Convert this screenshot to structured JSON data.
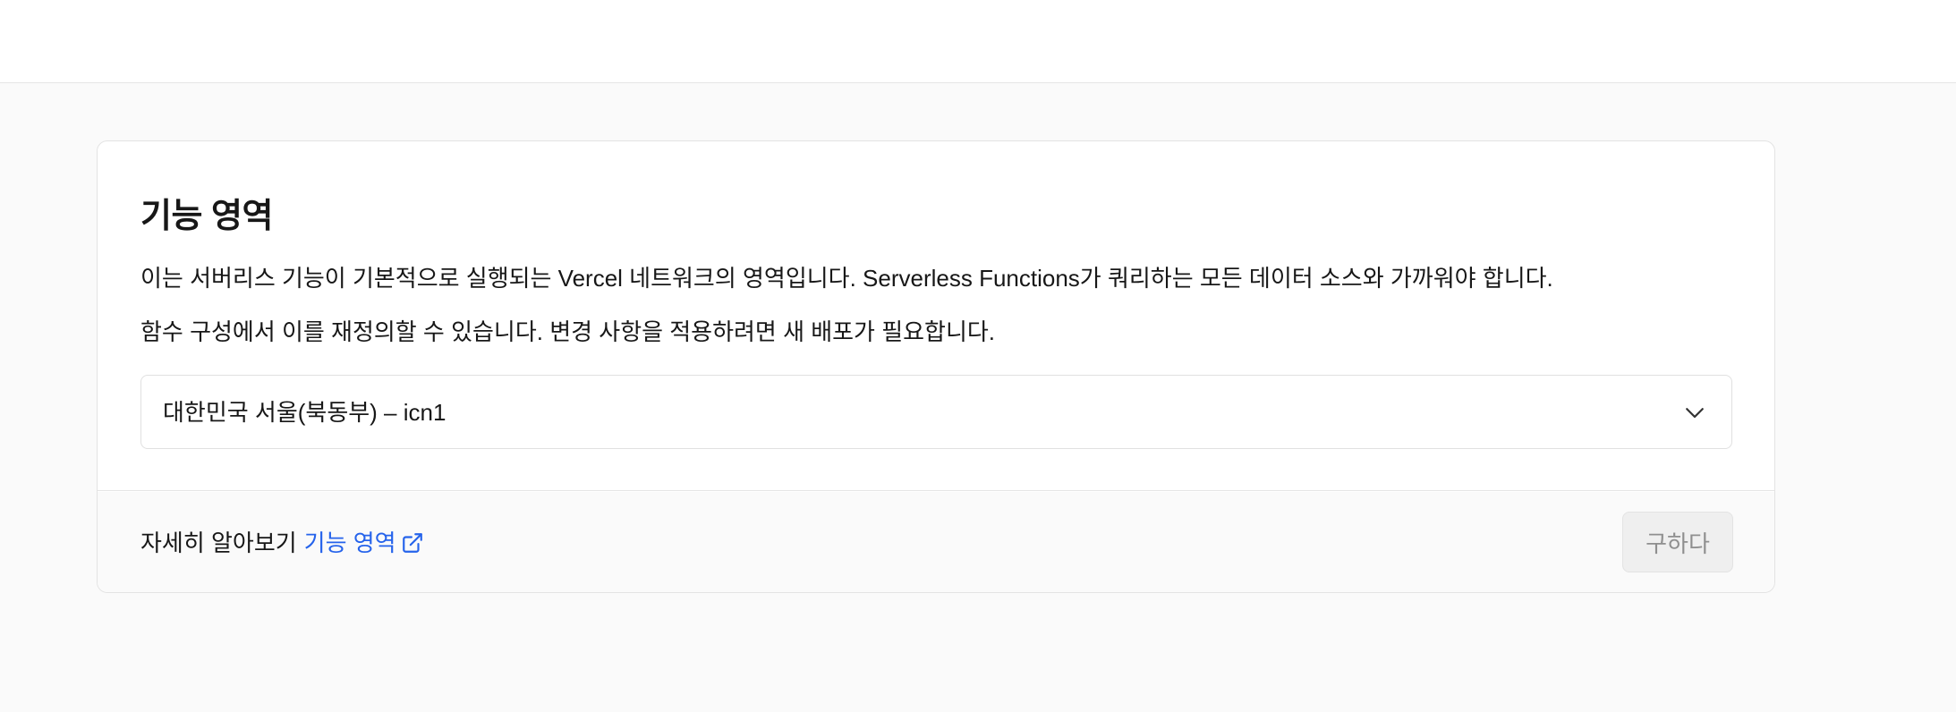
{
  "card": {
    "title": "기능 영역",
    "description_1": "이는 서버리스 기능이 기본적으로 실행되는 Vercel 네트워크의 영역입니다. Serverless Functions가 쿼리하는 모든 데이터 소스와 가까워야 합니다.",
    "description_2": "함수 구성에서 이를 재정의할 수 있습니다. 변경 사항을 적용하려면 새 배포가 필요합니다.",
    "region_select": {
      "value": "대한민국 서울(북동부) – icn1",
      "icon": "chevron-down-icon"
    }
  },
  "footer": {
    "learn_prefix": "자세히 알아보기",
    "learn_link": "기능 영역",
    "link_icon": "external-link-icon",
    "submit_label": "구하다"
  },
  "colors": {
    "page_background": "#fafafa",
    "card_background": "#ffffff",
    "link": "#2563eb",
    "disabled_button_background": "#efefef",
    "disabled_button_text": "#8f8f8f"
  }
}
